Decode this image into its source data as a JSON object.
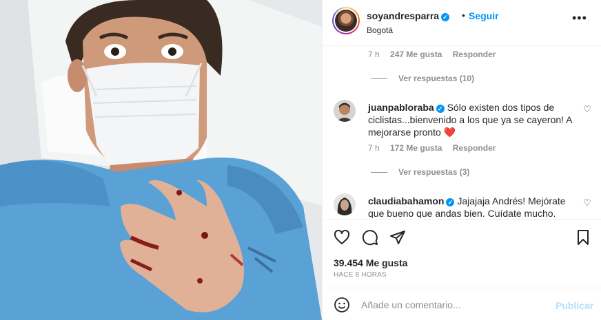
{
  "post": {
    "username": "soyandresparra",
    "follow_label": "Seguir",
    "separator": "•",
    "location": "Bogotá",
    "more_label": "•••"
  },
  "comments": [
    {
      "time": "7 h",
      "likes": "247 Me gusta",
      "reply_label": "Responder",
      "view_replies": "Ver respuestas (10)"
    },
    {
      "username": "juanpabloraba",
      "text": "Sólo existen dos tipos de ciclistas...bienvenido a los que ya se cayeron! A mejorarse pronto",
      "emoji": "❤️",
      "time": "7 h",
      "likes": "172 Me gusta",
      "reply_label": "Responder",
      "view_replies": "Ver respuestas (3)"
    },
    {
      "username": "claudiabahamon",
      "text": "Jajajaja Andrés! Mejórate que bueno que andas bien. Cuídate mucho."
    }
  ],
  "stats": {
    "likes": "39.454 Me gusta",
    "time_ago": "HACE 8 HORAS"
  },
  "add_comment": {
    "placeholder": "Añade un comentario...",
    "publish_label": "Publicar"
  },
  "icons": [
    "heart-icon",
    "comment-icon",
    "share-icon",
    "bookmark-icon",
    "emoji-icon",
    "verified-icon",
    "more-icon"
  ],
  "colors": {
    "accent": "#0095f6",
    "publish_disabled": "#b2dffc",
    "muted": "#8e8e8e",
    "text": "#262626"
  }
}
